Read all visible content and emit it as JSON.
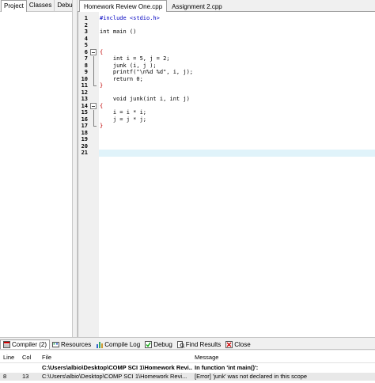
{
  "left_panel": {
    "tabs": [
      "Project",
      "Classes",
      "Debug"
    ]
  },
  "editor": {
    "tabs": [
      "Homework Review One.cpp",
      "Assignment 2.cpp"
    ],
    "current_line": 21,
    "lines": [
      {
        "n": "1",
        "text": "#include <stdio.h>",
        "color": "#0000c0"
      },
      {
        "n": "2",
        "text": "",
        "color": "#000000"
      },
      {
        "n": "3",
        "text": "int main ()",
        "color": "#000000"
      },
      {
        "n": "4",
        "text": "",
        "color": "#000000"
      },
      {
        "n": "5",
        "text": "",
        "color": "#000000"
      },
      {
        "n": "6",
        "text": "{",
        "color": "#c00000"
      },
      {
        "n": "7",
        "text": "    int i = 5, j = 2;",
        "color": "#000000"
      },
      {
        "n": "8",
        "text": "    junk (i, j );",
        "color": "#000000"
      },
      {
        "n": "9",
        "text": "    printf(\"\\n%d %d\", i, j);",
        "color": "#000000"
      },
      {
        "n": "10",
        "text": "    return 0;",
        "color": "#000000"
      },
      {
        "n": "11",
        "text": "}",
        "color": "#c00000"
      },
      {
        "n": "12",
        "text": "",
        "color": "#000000"
      },
      {
        "n": "13",
        "text": "    void junk(int i, int j)",
        "color": "#000000"
      },
      {
        "n": "14",
        "text": "{",
        "color": "#c00000"
      },
      {
        "n": "15",
        "text": "    i = i * i;",
        "color": "#000000"
      },
      {
        "n": "16",
        "text": "    j = j * j;",
        "color": "#000000"
      },
      {
        "n": "17",
        "text": "}",
        "color": "#c00000"
      },
      {
        "n": "18",
        "text": "",
        "color": "#000000"
      },
      {
        "n": "19",
        "text": "",
        "color": "#000000"
      },
      {
        "n": "20",
        "text": "",
        "color": "#000000"
      },
      {
        "n": "21",
        "text": "",
        "color": "#000000"
      }
    ]
  },
  "bottom_panel": {
    "tabs": [
      {
        "label": "Compiler (2)",
        "icon": "compiler-grid-icon"
      },
      {
        "label": "Resources",
        "icon": "resources-icon"
      },
      {
        "label": "Compile Log",
        "icon": "compile-log-chart-icon"
      },
      {
        "label": "Debug",
        "icon": "debug-check-icon"
      },
      {
        "label": "Find Results",
        "icon": "find-results-icon"
      },
      {
        "label": "Close",
        "icon": "close-icon"
      }
    ],
    "columns": [
      "Line",
      "Col",
      "File",
      "Message"
    ],
    "rows": [
      {
        "line": "",
        "col": "",
        "file": "C:\\Users\\albio\\Desktop\\COMP SCI 1\\Homework Revi...",
        "message": "In function 'int main()':",
        "bold": true
      },
      {
        "line": "8",
        "col": "13",
        "file": "C:\\Users\\albio\\Desktop\\COMP SCI 1\\Homework Revi...",
        "message": "[Error] 'junk' was not declared in this scope",
        "bold": false
      }
    ]
  },
  "colors": {
    "current_line": "#e0f3fa",
    "keyword_red": "#c00000",
    "preprocessor_blue": "#0000c0"
  }
}
